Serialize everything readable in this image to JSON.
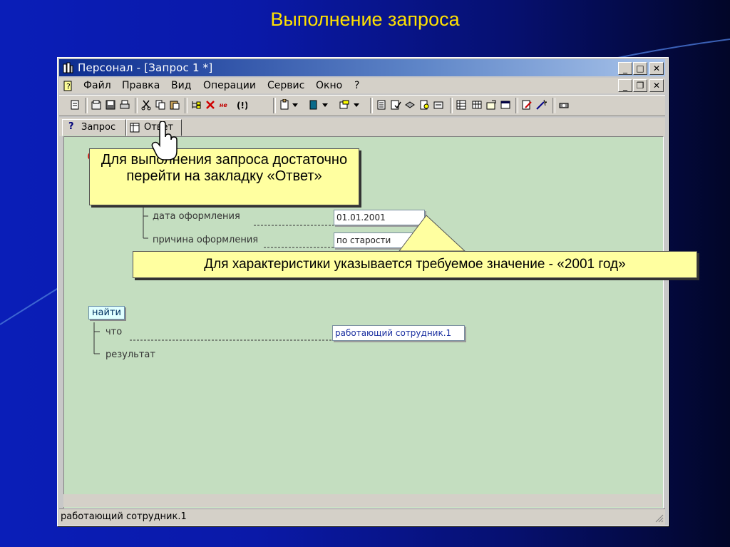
{
  "slide": {
    "title": "Выполнение запроса"
  },
  "window": {
    "title": "Персонал - [Запрос 1 *]",
    "menu": [
      "Файл",
      "Правка",
      "Вид",
      "Операции",
      "Сервис",
      "Окно",
      "?"
    ],
    "tabs": [
      {
        "label": "Запрос",
        "icon": "question-icon"
      },
      {
        "label": "Ответ",
        "icon": "table-icon"
      }
    ],
    "status": "работающий сотрудник.1"
  },
  "query": {
    "fields": [
      {
        "label": "дата оформления",
        "value": "01.01.2001"
      },
      {
        "label": "причина оформления",
        "value": "по старости"
      }
    ],
    "find": {
      "title": "найти",
      "what_label": "что",
      "what_value": "работающий сотрудник.1",
      "result_label": "результат"
    }
  },
  "callouts": {
    "tab_hint": "Для выполнения запроса достаточно перейти на закладку «Ответ»",
    "value_hint": "Для характеристики указывается требуемое значение - «2001 год»"
  },
  "colors": {
    "title": "#ffe100",
    "callout": "#ffffa0",
    "workspace": "#c4dec0"
  }
}
